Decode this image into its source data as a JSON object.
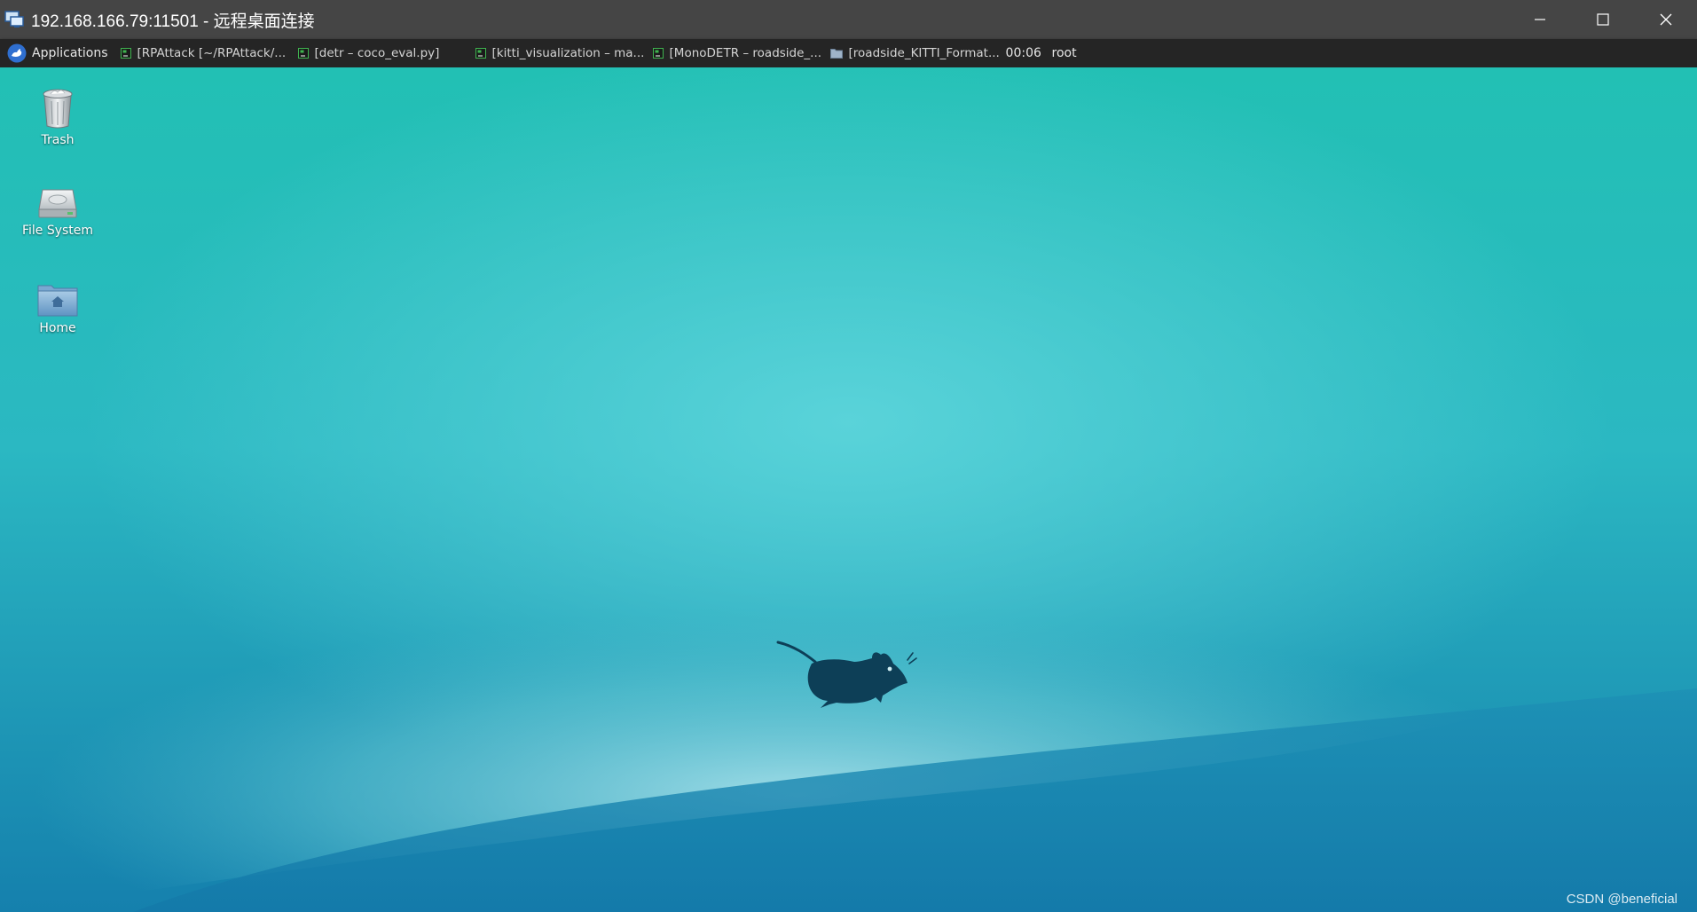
{
  "window": {
    "title": "192.168.166.79:11501 - 远程桌面连接",
    "icon": "remote-desktop-icon",
    "controls": [
      "minimize-icon",
      "maximize-icon",
      "close-icon"
    ]
  },
  "panel": {
    "applications_label": "Applications",
    "tasks": [
      {
        "label": "[RPAttack [~/RPAttack/...",
        "icon": "pycharm-icon"
      },
      {
        "label": "[detr – coco_eval.py]",
        "icon": "pycharm-icon"
      },
      {
        "label": "[kitti_visualization – ma...",
        "icon": "pycharm-icon"
      },
      {
        "label": "[MonoDETR – roadside_...",
        "icon": "pycharm-icon"
      },
      {
        "label": "[roadside_KITTI_Format...",
        "icon": "folder-icon"
      }
    ],
    "clock": "00:06",
    "user": "root"
  },
  "desktop": {
    "icons": [
      {
        "label": "Trash",
        "icon": "trash-icon"
      },
      {
        "label": "File System",
        "icon": "hard-drive-icon"
      },
      {
        "label": "Home",
        "icon": "home-folder-icon"
      }
    ],
    "wallpaper_logo": "xfce-mouse-logo",
    "watermark": "CSDN @beneficial"
  },
  "colors": {
    "titlebar": "#454545",
    "panel": "#252525",
    "wallpaper_top": "#22c0b4",
    "wallpaper_bottom": "#1580ad"
  }
}
